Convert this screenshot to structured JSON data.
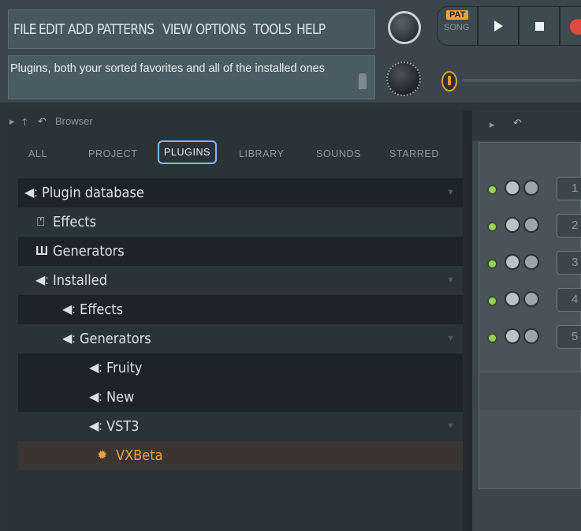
{
  "menu": {
    "items": [
      "FILE",
      "EDIT",
      "ADD",
      "PATTERNS",
      "VIEW",
      "OPTIONS",
      "TOOLS",
      "HELP"
    ]
  },
  "hint": {
    "text": "Plugins, both your sorted favorites and all of the installed ones"
  },
  "transport": {
    "pat_label": "PAT",
    "song_label": "SONG"
  },
  "browser": {
    "title": "Browser",
    "tabs": [
      "ALL",
      "PROJECT",
      "PLUGINS",
      "LIBRARY",
      "SOUNDS",
      "STARRED"
    ],
    "active_tab": "PLUGINS",
    "tree": [
      {
        "label": "Plugin database"
      },
      {
        "label": "Effects"
      },
      {
        "label": "Generators"
      },
      {
        "label": "Installed"
      },
      {
        "label": "Effects"
      },
      {
        "label": "Generators"
      },
      {
        "label": "Fruity"
      },
      {
        "label": "New"
      },
      {
        "label": "VST3"
      },
      {
        "label": "VXBeta"
      }
    ]
  },
  "channel_rack": {
    "channels": [
      "1",
      "2",
      "3",
      "4",
      "5"
    ]
  },
  "colors": {
    "accent_orange": "#f5a23d",
    "active_tab_border": "#8ab6ff",
    "led_green": "#94d35c"
  }
}
